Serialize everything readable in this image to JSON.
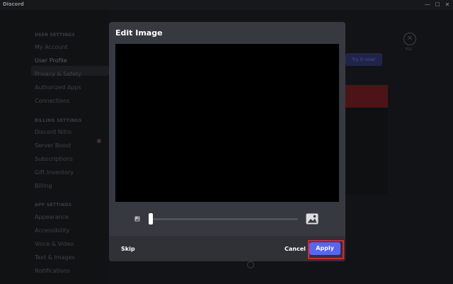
{
  "window": {
    "title": "Discord",
    "minimize": "—",
    "maximize": "☐",
    "close": "✕"
  },
  "sidebar": {
    "user_settings": {
      "header": "USER SETTINGS",
      "items": [
        "My Account",
        "User Profile",
        "Privacy & Safety",
        "Authorized Apps",
        "Connections"
      ]
    },
    "billing_settings": {
      "header": "BILLING SETTINGS",
      "items": [
        "Discord Nitro",
        "Server Boost",
        "Subscriptions",
        "Gift Inventory",
        "Billing"
      ]
    },
    "app_settings": {
      "header": "APP SETTINGS",
      "items": [
        "Appearance",
        "Accessibility",
        "Voice & Video",
        "Text & Images",
        "Notifications"
      ]
    }
  },
  "background": {
    "try_it_button": "Try it now!",
    "esc_label": "ESC",
    "close_glyph": "✕"
  },
  "modal": {
    "title": "Edit Image",
    "zoom": 0,
    "skip_label": "Skip",
    "cancel_label": "Cancel",
    "apply_label": "Apply"
  },
  "colors": {
    "accent": "#5865f2",
    "highlight": "#e0242d",
    "modal_bg": "#36393f",
    "footer_bg": "#2f3136"
  }
}
